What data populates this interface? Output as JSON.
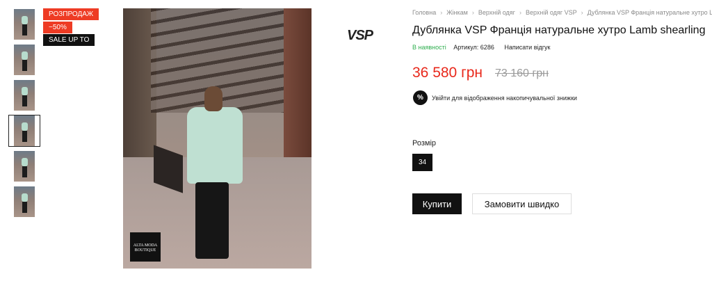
{
  "badges": {
    "sale": "РОЗПРОДАЖ",
    "discount": "−50%",
    "sale_up_to": "SALE UP TO"
  },
  "gallery": {
    "thumbnail_count": 6,
    "active_thumbnail": 4,
    "main_image_logo_line1": "ALTA MODA",
    "main_image_logo_line2": "BOUTIQUE"
  },
  "brand": "VSP",
  "breadcrumb": {
    "items": [
      "Головна",
      "Жінкам",
      "Верхній одяг",
      "Верхній одяг VSP",
      "Дублянка VSP Франція натуральне хутро Lamb shearling"
    ],
    "separator_icon": "chevron-right-icon"
  },
  "product": {
    "title": "Дублянка VSP Франція натуральне хутро Lamb shearling",
    "stock": "В наявності",
    "sku": "Артикул: 6286",
    "review_link": "Написати відгук",
    "price": "36 580 грн",
    "old_price": "73 160 грн",
    "discount_note": "Увійти для відображення накопичувальної знижки",
    "discount_icon": "%",
    "size_label": "Розмір",
    "sizes": [
      "34"
    ],
    "buy_button": "Купити",
    "quick_order_button": "Замовити швидко"
  },
  "colors": {
    "accent_red": "#e8281b",
    "stock_green": "#2eae4e",
    "button_black": "#111111"
  }
}
